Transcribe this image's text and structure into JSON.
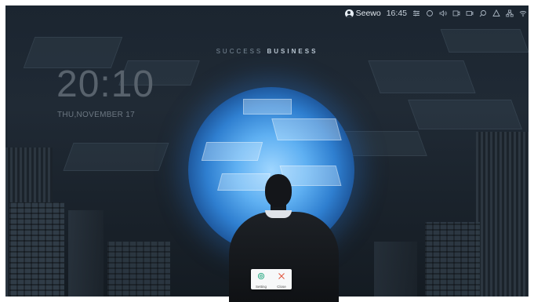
{
  "status_bar": {
    "user_name": "Seewo",
    "time": "16:45",
    "icons": [
      "sliders-icon",
      "refresh-icon",
      "volume-icon",
      "screen-icon",
      "camera-icon",
      "search-icon",
      "warning-icon",
      "network-icon",
      "wifi-icon"
    ]
  },
  "banner": {
    "light": "SUCCESS",
    "bold": "BUSINESS"
  },
  "lock_screen": {
    "time": "20:10",
    "date": "THU,NOVEMBER 17"
  },
  "dialog": {
    "setting_label": "Setting",
    "close_label": "Close",
    "accent_color": "#1aa37a",
    "close_color": "#e0533a"
  }
}
